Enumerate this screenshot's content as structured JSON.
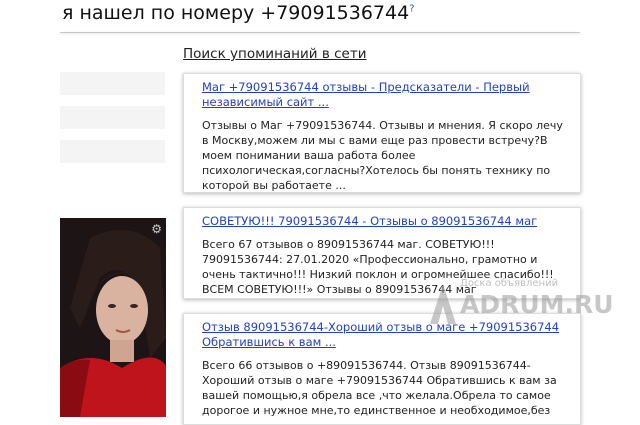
{
  "header": {
    "title": "я нашел по номеру +79091536744",
    "help_mark": "?"
  },
  "section": {
    "link": "Поиск упоминаний в сети"
  },
  "results": [
    {
      "title": "Маг +79091536744 отзывы - Предсказатели - Первый независимый сайт ...",
      "snippet": "Отзывы о Маг +79091536744. Отзывы и мнения. Я скоро лечу в Москву,можем ли мы с вами еще раз провести встречу?В моем понимании ваша работа более психологическая,согласны?Хотелось бы понять технику по которой вы работаете ..."
    },
    {
      "title": "СОВЕТУЮ!!! 79091536744 - Отзывы о 89091536744 маг",
      "snippet": "Всего 67 отзывов о 89091536744 маг. СОВЕТУЮ!!! 79091536744: 27.01.2020 «Профессионально, грамотно и очень тактично!!! Низкий поклон и огромнейшее спасибо!!! ВСЕМ СОВЕТУЮ!!!» Отзывы о 89091536744 маг"
    },
    {
      "title": "Отзыв 89091536744-Хороший отзыв о маге +79091536744 Обратившись к вам ...",
      "snippet": "Всего 66 отзывов о +89091536744. Отзыв 89091536744- Хороший отзыв о маге +79091536744 Обратившись к вам за вашей помощью,я обрела все ,что желала.Обрела то самое дорогое и нужное мне,то единственное и необходимое,без"
    }
  ],
  "watermark": {
    "line1": "Доска объявлений",
    "line2": "ADRUM.RU"
  },
  "colors": {
    "link": "#2440c0",
    "photo_red": "#c0141c"
  }
}
